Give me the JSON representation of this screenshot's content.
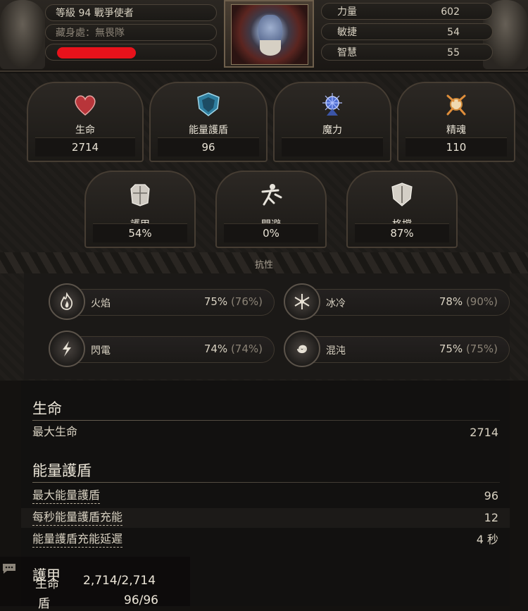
{
  "header": {
    "level_label": "等級",
    "level_value": "94",
    "class_name": "戰爭使者",
    "stash_label": "藏身處：無畏隊",
    "attributes": [
      {
        "label": "力量",
        "value": "602"
      },
      {
        "label": "敏捷",
        "value": "54"
      },
      {
        "label": "智慧",
        "value": "55"
      }
    ]
  },
  "pools": [
    {
      "label": "生命",
      "value": "2714",
      "icon": "heart-icon",
      "color": "#c0393b"
    },
    {
      "label": "能量護盾",
      "value": "96",
      "icon": "energy-shield-icon",
      "color": "#3fa3c8"
    },
    {
      "label": "魔力",
      "value": "",
      "icon": "mana-icon",
      "color": "#5a78d6"
    },
    {
      "label": "精魂",
      "value": "110",
      "icon": "spirit-icon",
      "color": "#e0a64a"
    }
  ],
  "defences": [
    {
      "label": "護甲",
      "value": "54%",
      "icon": "armour-icon"
    },
    {
      "label": "閃避",
      "value": "0%",
      "icon": "evasion-icon"
    },
    {
      "label": "格擋",
      "value": "87%",
      "icon": "block-icon"
    }
  ],
  "resistances_title": "抗性",
  "resistances": [
    {
      "label": "火焰",
      "value": "75%",
      "max": "(76%)",
      "icon": "fire-icon"
    },
    {
      "label": "冰冷",
      "value": "78%",
      "max": "(90%)",
      "icon": "cold-icon"
    },
    {
      "label": "閃電",
      "value": "74%",
      "max": "(74%)",
      "icon": "lightning-icon"
    },
    {
      "label": "混沌",
      "value": "75%",
      "max": "(75%)",
      "icon": "chaos-icon"
    }
  ],
  "details": {
    "life_title": "生命",
    "life_rows": [
      {
        "label": "最大生命",
        "value": "2714"
      }
    ],
    "es_title": "能量護盾",
    "es_rows": [
      {
        "label": "最大能量護盾",
        "value": "96"
      },
      {
        "label": "每秒能量護盾充能",
        "value": "12"
      },
      {
        "label": "能量護盾充能延遲",
        "value": "4 秒"
      }
    ]
  },
  "tooltip": {
    "title": "護甲",
    "life_label": "生命",
    "life_value": "2,714/2,714",
    "shield_label": "盾",
    "shield_value": "96/96"
  }
}
